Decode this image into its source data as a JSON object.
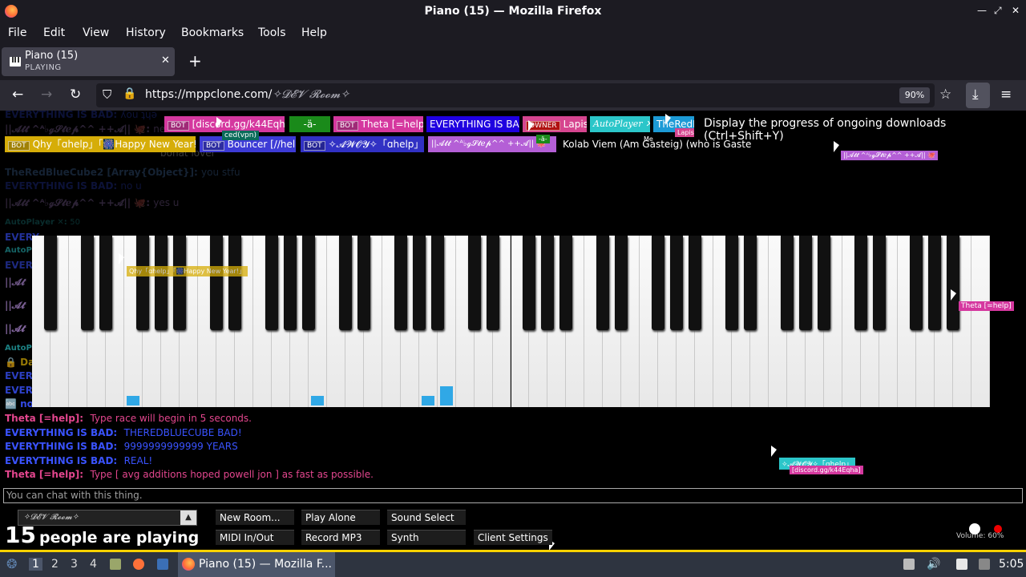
{
  "window": {
    "title": "Piano (15) — Mozilla Firefox"
  },
  "menu": [
    "File",
    "Edit",
    "View",
    "History",
    "Bookmarks",
    "Tools",
    "Help"
  ],
  "tab": {
    "title": "Piano (15)",
    "subtitle": "PLAYING"
  },
  "nav": {
    "url_host": "https://mppclone.com/",
    "url_path": "✧𝓓𝓔𝓥 𝓡𝓸𝓸𝓶✧",
    "zoom": "90%"
  },
  "tooltip": "Display the progress of ongoing downloads (Ctrl+Shift+Y)",
  "players": {
    "row1": [
      {
        "bot": "BOT",
        "name": "[discord.gg/k44Eqha]",
        "color": "#d5389f"
      },
      {
        "bot": "",
        "name": "-ä-",
        "color": "#1a8a1a"
      },
      {
        "bot": "BOT",
        "name": "Theta [=help]",
        "color": "#d5389f"
      },
      {
        "bot": "",
        "name": "EVERYTHING IS BAD",
        "color": "#1f00e0"
      },
      {
        "bot": "OWNER",
        "name": "Lapis",
        "color": "#d6458f"
      },
      {
        "bot": "",
        "name": "AutoPlayer ✕",
        "color": "#2bc6c9"
      },
      {
        "bot": "",
        "name": "TheRedB",
        "color": "#1c9ad6"
      }
    ],
    "row2": [
      {
        "bot": "BOT",
        "name": "Qhy「ɑhelp」「🎆Happy New Year!」",
        "color": "#d6ad08"
      },
      {
        "bot": "BOT",
        "name": "Bouncer [//help]",
        "color": "#3d3bd6"
      },
      {
        "bot": "BOT",
        "name": "✧𝓐𝓦𝓞𝓨✧「ɑhelp」",
        "color": "#3131c4"
      },
      {
        "bot": "",
        "name": "||𝓐𝓽𝓽 ^ᴬ♭ℊ𝓢𝓽ℯ𝓹^^ ++𝓐|| 🐙",
        "color": "#b45fd6"
      },
      {
        "bot": "",
        "name": "Kolab Viem (Am Gasteig) (who is Gasteig)",
        "color": "#000000"
      }
    ],
    "cursor_labels": [
      "ced(vpn)",
      "Lapis",
      "Me",
      "-ä-"
    ]
  },
  "faded_chat": [
    {
      "name": "EVERYTHING IS BAD:",
      "msg": "ʎou ʇɥǝ",
      "color": "#3a53ff"
    },
    {
      "name": "||𝓐𝓽𝓽 ^ᴬ♭ℊ𝓢𝓽ℯ𝓹^^ ++𝓐|| 🐙:",
      "msg": "ne",
      "color": "#c79bf0"
    },
    {
      "name": "",
      "msg": "bonat lover",
      "color": "#ffffff"
    },
    {
      "name": "TheRedBlueCube2 [Array{Object}]:",
      "msg": "you stfu",
      "color": "#5f9ae6"
    },
    {
      "name": "EVERYTHING IS BAD:",
      "msg": "no u",
      "color": "#3a53ff"
    },
    {
      "name": "||𝓐𝓽𝓽 ^ᴬ♭ℊ𝓢𝓽ℯ𝓹^^ ++𝓐|| 🐙:",
      "msg": "yes u",
      "color": "#c79bf0"
    },
    {
      "name": "AutoPlayer ✕:",
      "msg": "50",
      "color": "#2bc6c9"
    }
  ],
  "side_chat": [
    {
      "name": "EVERY",
      "color": "#3a53ff"
    },
    {
      "name": "AutoPl",
      "color": "#2bc6c9"
    },
    {
      "name": "EVER",
      "color": "#3a53ff"
    },
    {
      "name": "||𝓐𝓽",
      "color": "#c79bf0"
    },
    {
      "name": "||𝓐𝓽",
      "color": "#c79bf0"
    },
    {
      "name": "||𝓐𝓽",
      "color": "#c79bf0"
    },
    {
      "name": "AutoPl",
      "color": "#2bc6c9"
    },
    {
      "name": "🔒 Da",
      "color": "#d6ad08"
    },
    {
      "name": "EVER",
      "color": "#3a53ff"
    },
    {
      "name": "EVER",
      "color": "#3a53ff"
    },
    {
      "name": "TheR",
      "color": "#1c9ad6"
    },
    {
      "name": "🔤 no",
      "color": "#3a53ff"
    }
  ],
  "chat": [
    {
      "name": "Theta [=help]:",
      "msg": "Type race will begin in 5 seconds.",
      "color": "#e3468e"
    },
    {
      "name": "EVERYTHING IS BAD:",
      "msg": "THEREDBLUECUBE BAD!",
      "color": "#3a53ff"
    },
    {
      "name": "EVERYTHING IS BAD:",
      "msg": "9999999999999 YEARS",
      "color": "#3a53ff"
    },
    {
      "name": "EVERYTHING IS BAD:",
      "msg": "REAL!",
      "color": "#3a53ff"
    },
    {
      "name": "Theta [=help]:",
      "msg": "Type [ avg additions hoped powell jon ] as fast as possible.",
      "color": "#e3468e"
    }
  ],
  "cursors": [
    {
      "label": "Qhy「ɑhelp」「🎆Happy New Year!」",
      "color": "#d6ad08"
    },
    {
      "label": "Theta [=help]",
      "color": "#d5389f"
    },
    {
      "label": "||𝓐𝓽𝓽 ^ᴬ♭ℊ𝓢𝓽ℯ𝓹^^ ++𝓐|| 🐙",
      "color": "#b45fd6"
    },
    {
      "label": "✧𝓐𝓦𝓞𝓨✧「ɑhelp」",
      "color": "#2bc6c9"
    },
    {
      "label": "[discord.gg/k44Eqha]",
      "color": "#d5389f"
    }
  ],
  "chat_placeholder": "You can chat with this thing.",
  "room_select": "✧𝓓𝓔𝓥 𝓡𝓸𝓸𝓶✧",
  "player_count": {
    "number": "15",
    "label": "people are playing"
  },
  "buttons": [
    "New Room...",
    "Play Alone",
    "Sound Select",
    "MIDI In/Out",
    "Record MP3",
    "Synth",
    "Client Settings"
  ],
  "volume": "Volume: 60%",
  "taskbar": {
    "workspaces": [
      "1",
      "2",
      "3",
      "4"
    ],
    "app": "Piano (15) — Mozilla F...",
    "clock": "5:05"
  }
}
